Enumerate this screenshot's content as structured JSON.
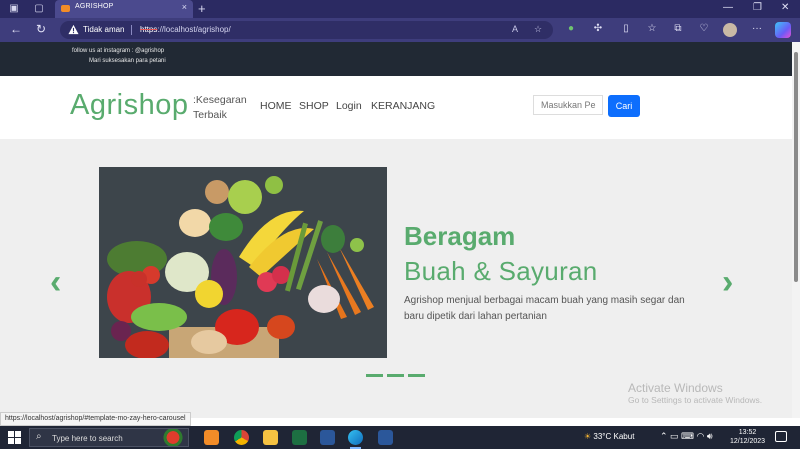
{
  "browser": {
    "tab_title": "AGRISHOP",
    "tab_close": "×",
    "new_tab": "+",
    "security_label": "Tidak aman",
    "url_scheme": "https",
    "url_rest": "://localhost/agrishop/",
    "window_controls": [
      "—",
      "❐",
      "✕"
    ],
    "status_url": "https://localhost/agrishop/#template-mo-zay-hero-carousel"
  },
  "topbar": {
    "instagram": "follow us at instagram : @agrishop",
    "motto": "Mari suksesakan para petani"
  },
  "header": {
    "logo": "Agrishop",
    "tagline": ":Kesegaran Terbaik",
    "menu": [
      "HOME",
      "SHOP",
      "Login",
      "KERANJANG"
    ],
    "search_placeholder": "Masukkan Pe",
    "search_button": "Cari"
  },
  "hero": {
    "title": "Beragam",
    "subtitle": "Buah & Sayuran",
    "description": "Agrishop menjual berbagai macam buah yang masih segar dan baru dipetik dari lahan pertanian",
    "prev_glyph": "‹",
    "next_glyph": "›",
    "indicators": 3
  },
  "watermark": {
    "title": "Activate Windows",
    "subtitle": "Go to Settings to activate Windows."
  },
  "taskbar": {
    "search_placeholder": "Type here to search",
    "weather": "33°C  Kabut",
    "time": "13:52",
    "date": "12/12/2023"
  },
  "colors": {
    "brand_green": "#59ab6e",
    "topbar": "#212934",
    "button_blue": "#0d6efd",
    "browser_chrome": "#2b2a62"
  }
}
